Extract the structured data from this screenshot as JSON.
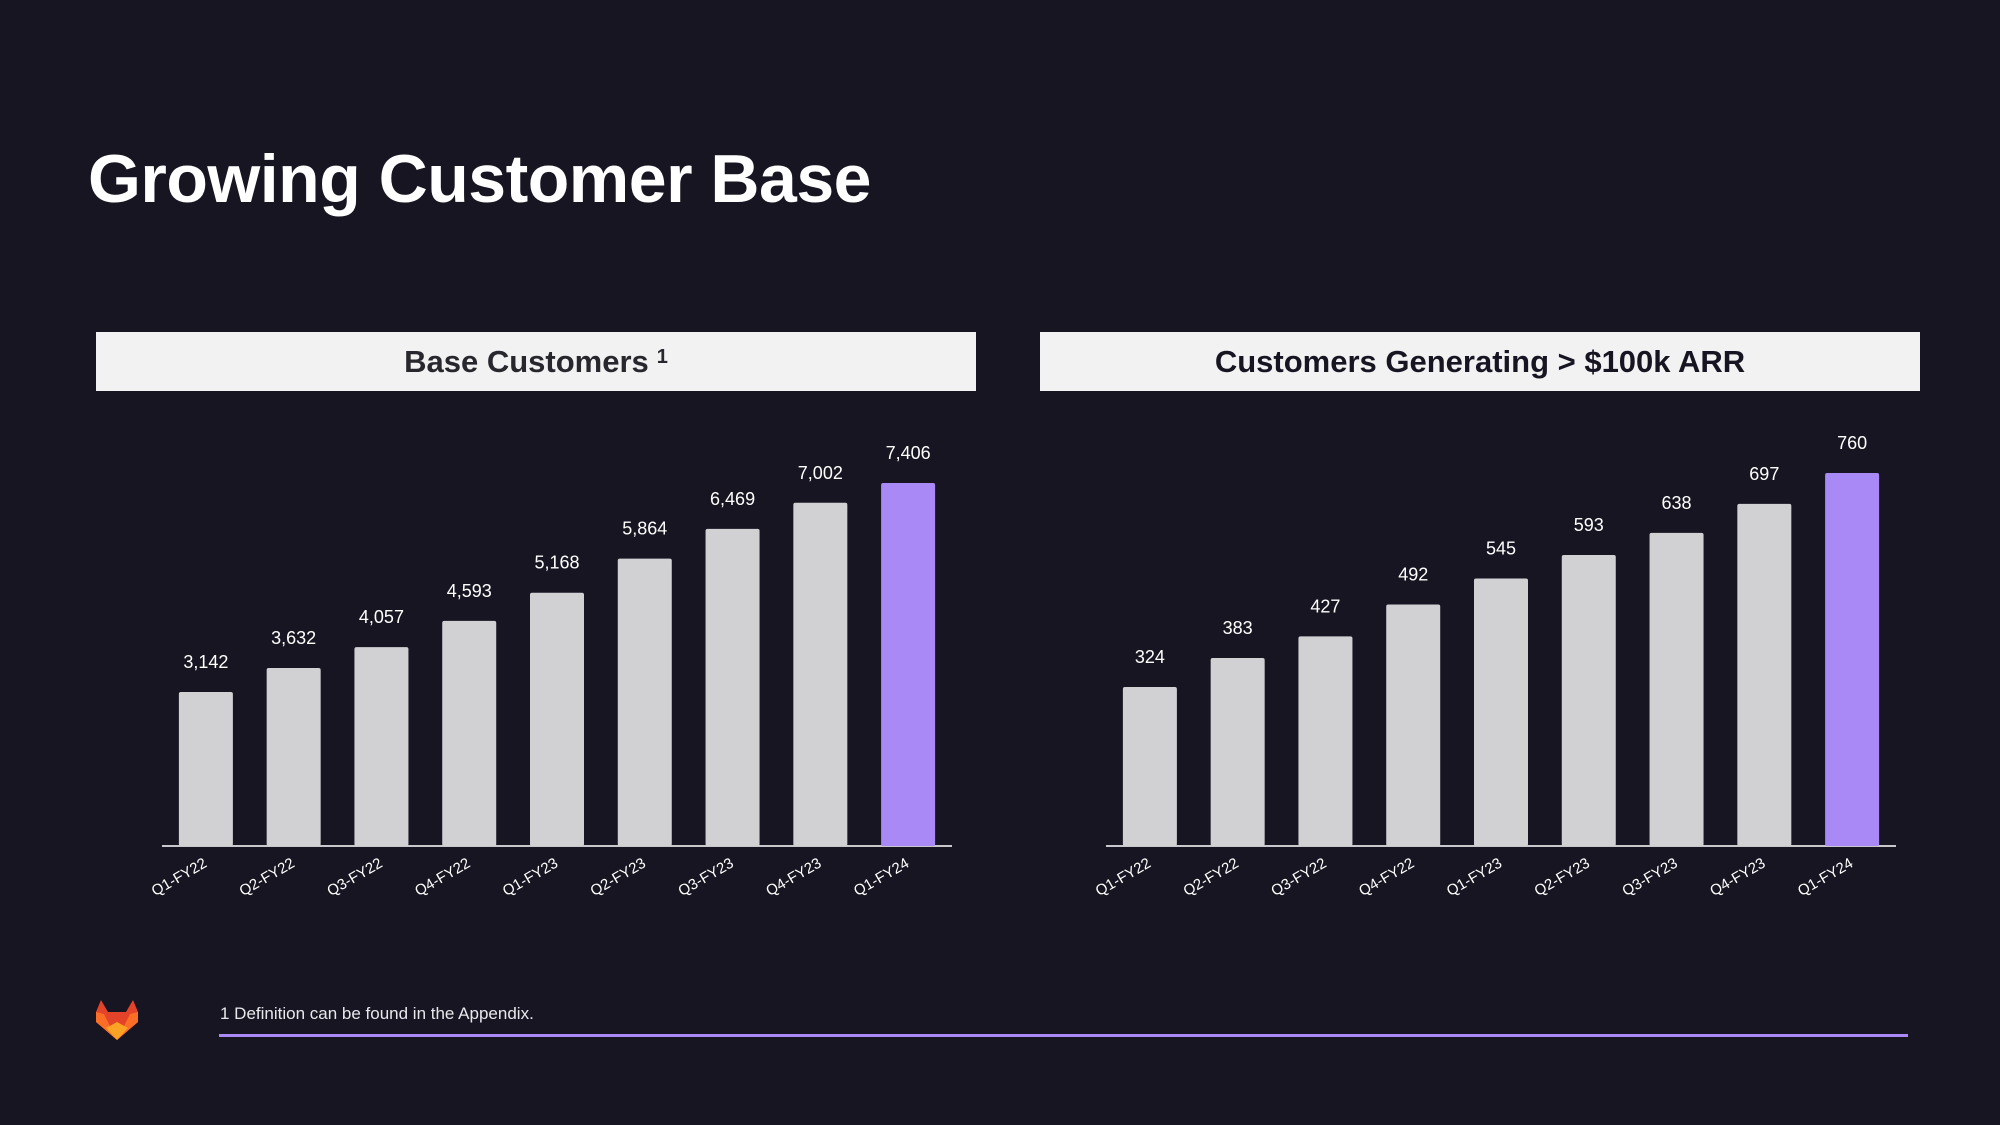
{
  "slide": {
    "title": "Growing Customer Base",
    "footnote": "1 Definition can be found in the Appendix.",
    "logo_icon": "gitlab-tanuki-logo"
  },
  "colors": {
    "background": "#171521",
    "bar_default": "#d1d1d4",
    "bar_highlight": "#a989f5",
    "header_bg": "#f2f2f3",
    "accent_rule": "#a989f5"
  },
  "chart_data": [
    {
      "type": "bar",
      "title": "Base Customers",
      "title_superscript": "1",
      "categories": [
        "Q1-FY22",
        "Q2-FY22",
        "Q3-FY22",
        "Q4-FY22",
        "Q1-FY23",
        "Q2-FY23",
        "Q3-FY23",
        "Q4-FY23",
        "Q1-FY24"
      ],
      "values": [
        3142,
        3632,
        4057,
        4593,
        5168,
        5864,
        6469,
        7002,
        7406
      ],
      "value_labels": [
        "3,142",
        "3,632",
        "4,057",
        "4,593",
        "5,168",
        "5,864",
        "6,469",
        "7,002",
        "7,406"
      ],
      "highlight_index": 8,
      "xlabel": "",
      "ylabel": "",
      "ylim": [
        0,
        7406
      ],
      "grid": false,
      "legend": "none"
    },
    {
      "type": "bar",
      "title": "Customers Generating > $100k ARR",
      "title_superscript": "",
      "categories": [
        "Q1-FY22",
        "Q2-FY22",
        "Q3-FY22",
        "Q4-FY22",
        "Q1-FY23",
        "Q2-FY23",
        "Q3-FY23",
        "Q4-FY23",
        "Q1-FY24"
      ],
      "values": [
        324,
        383,
        427,
        492,
        545,
        593,
        638,
        697,
        760
      ],
      "value_labels": [
        "324",
        "383",
        "427",
        "492",
        "545",
        "593",
        "638",
        "697",
        "760"
      ],
      "highlight_index": 8,
      "xlabel": "",
      "ylabel": "",
      "ylim": [
        0,
        760
      ],
      "grid": false,
      "legend": "none"
    }
  ]
}
